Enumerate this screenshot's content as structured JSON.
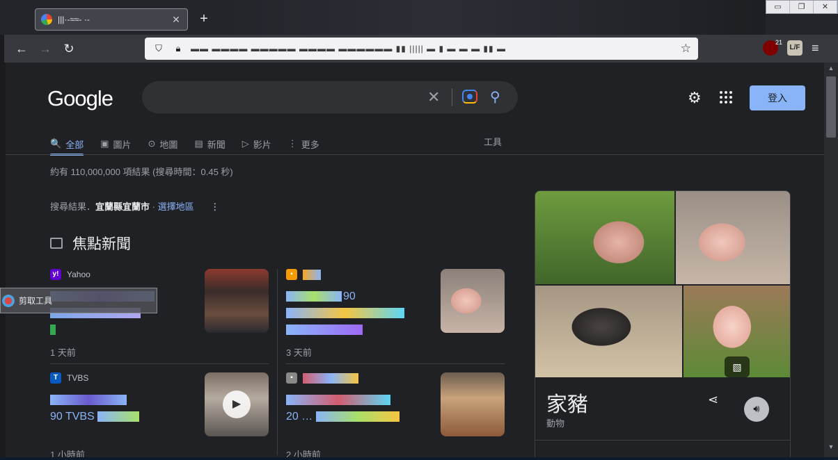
{
  "browser": {
    "tab_title": "|||·-≈≈-  ·-",
    "tab_close": "✕",
    "new_tab": "+",
    "url": "▬▬ ▬▬▬▬  ▬▬▬▬▬  ▬▬▬▬  ▬▬▬▬▬▬  ▮▮ |||||  ▬ ▮  ▬ ▬  ▬ ▮▮ ▬",
    "ublock_count": "21",
    "lf_label": "L/F",
    "window_controls": [
      "▭",
      "❐",
      "✕"
    ]
  },
  "google": {
    "logo": "Google",
    "signin": "登入",
    "tabs": [
      {
        "icon": "🔍",
        "label": "全部"
      },
      {
        "icon": "▣",
        "label": "圖片"
      },
      {
        "icon": "⊙",
        "label": "地圖"
      },
      {
        "icon": "▤",
        "label": "新聞"
      },
      {
        "icon": "▷",
        "label": "影片"
      },
      {
        "icon": "⋮",
        "label": "更多"
      }
    ],
    "tools": "工具",
    "stats": "約有 110,000,000 項結果 (搜尋時間：0.45 秒)",
    "region_prefix": "搜尋結果．",
    "region_name": "宜蘭縣宜蘭市",
    "region_sep": " · ",
    "region_link": "選擇地區",
    "news_heading": "焦點新聞"
  },
  "news": [
    {
      "source": "Yahoo",
      "logo": "y!",
      "logo_color": "#6001d2",
      "headline_text": "",
      "time": "1 天前"
    },
    {
      "source": "",
      "logo": "▪",
      "logo_color": "#f59b00",
      "headline_text": "90",
      "time": "3 天前"
    },
    {
      "source": "TVBS",
      "logo": "T",
      "logo_color": "#0a5ac4",
      "headline_text": "90 TVBS",
      "time": "1 小時前"
    },
    {
      "source": "",
      "logo": "▪",
      "logo_color": "#888888",
      "headline_text": "20 …",
      "time": "2 小時前"
    }
  ],
  "knowledge_panel": {
    "title": "家豬",
    "subtitle": "動物"
  },
  "snipping_tool": {
    "label": "剪取工具"
  },
  "colors": {
    "accent": "#8ab4f8",
    "background": "#202124",
    "text": "#bdc1c6"
  }
}
